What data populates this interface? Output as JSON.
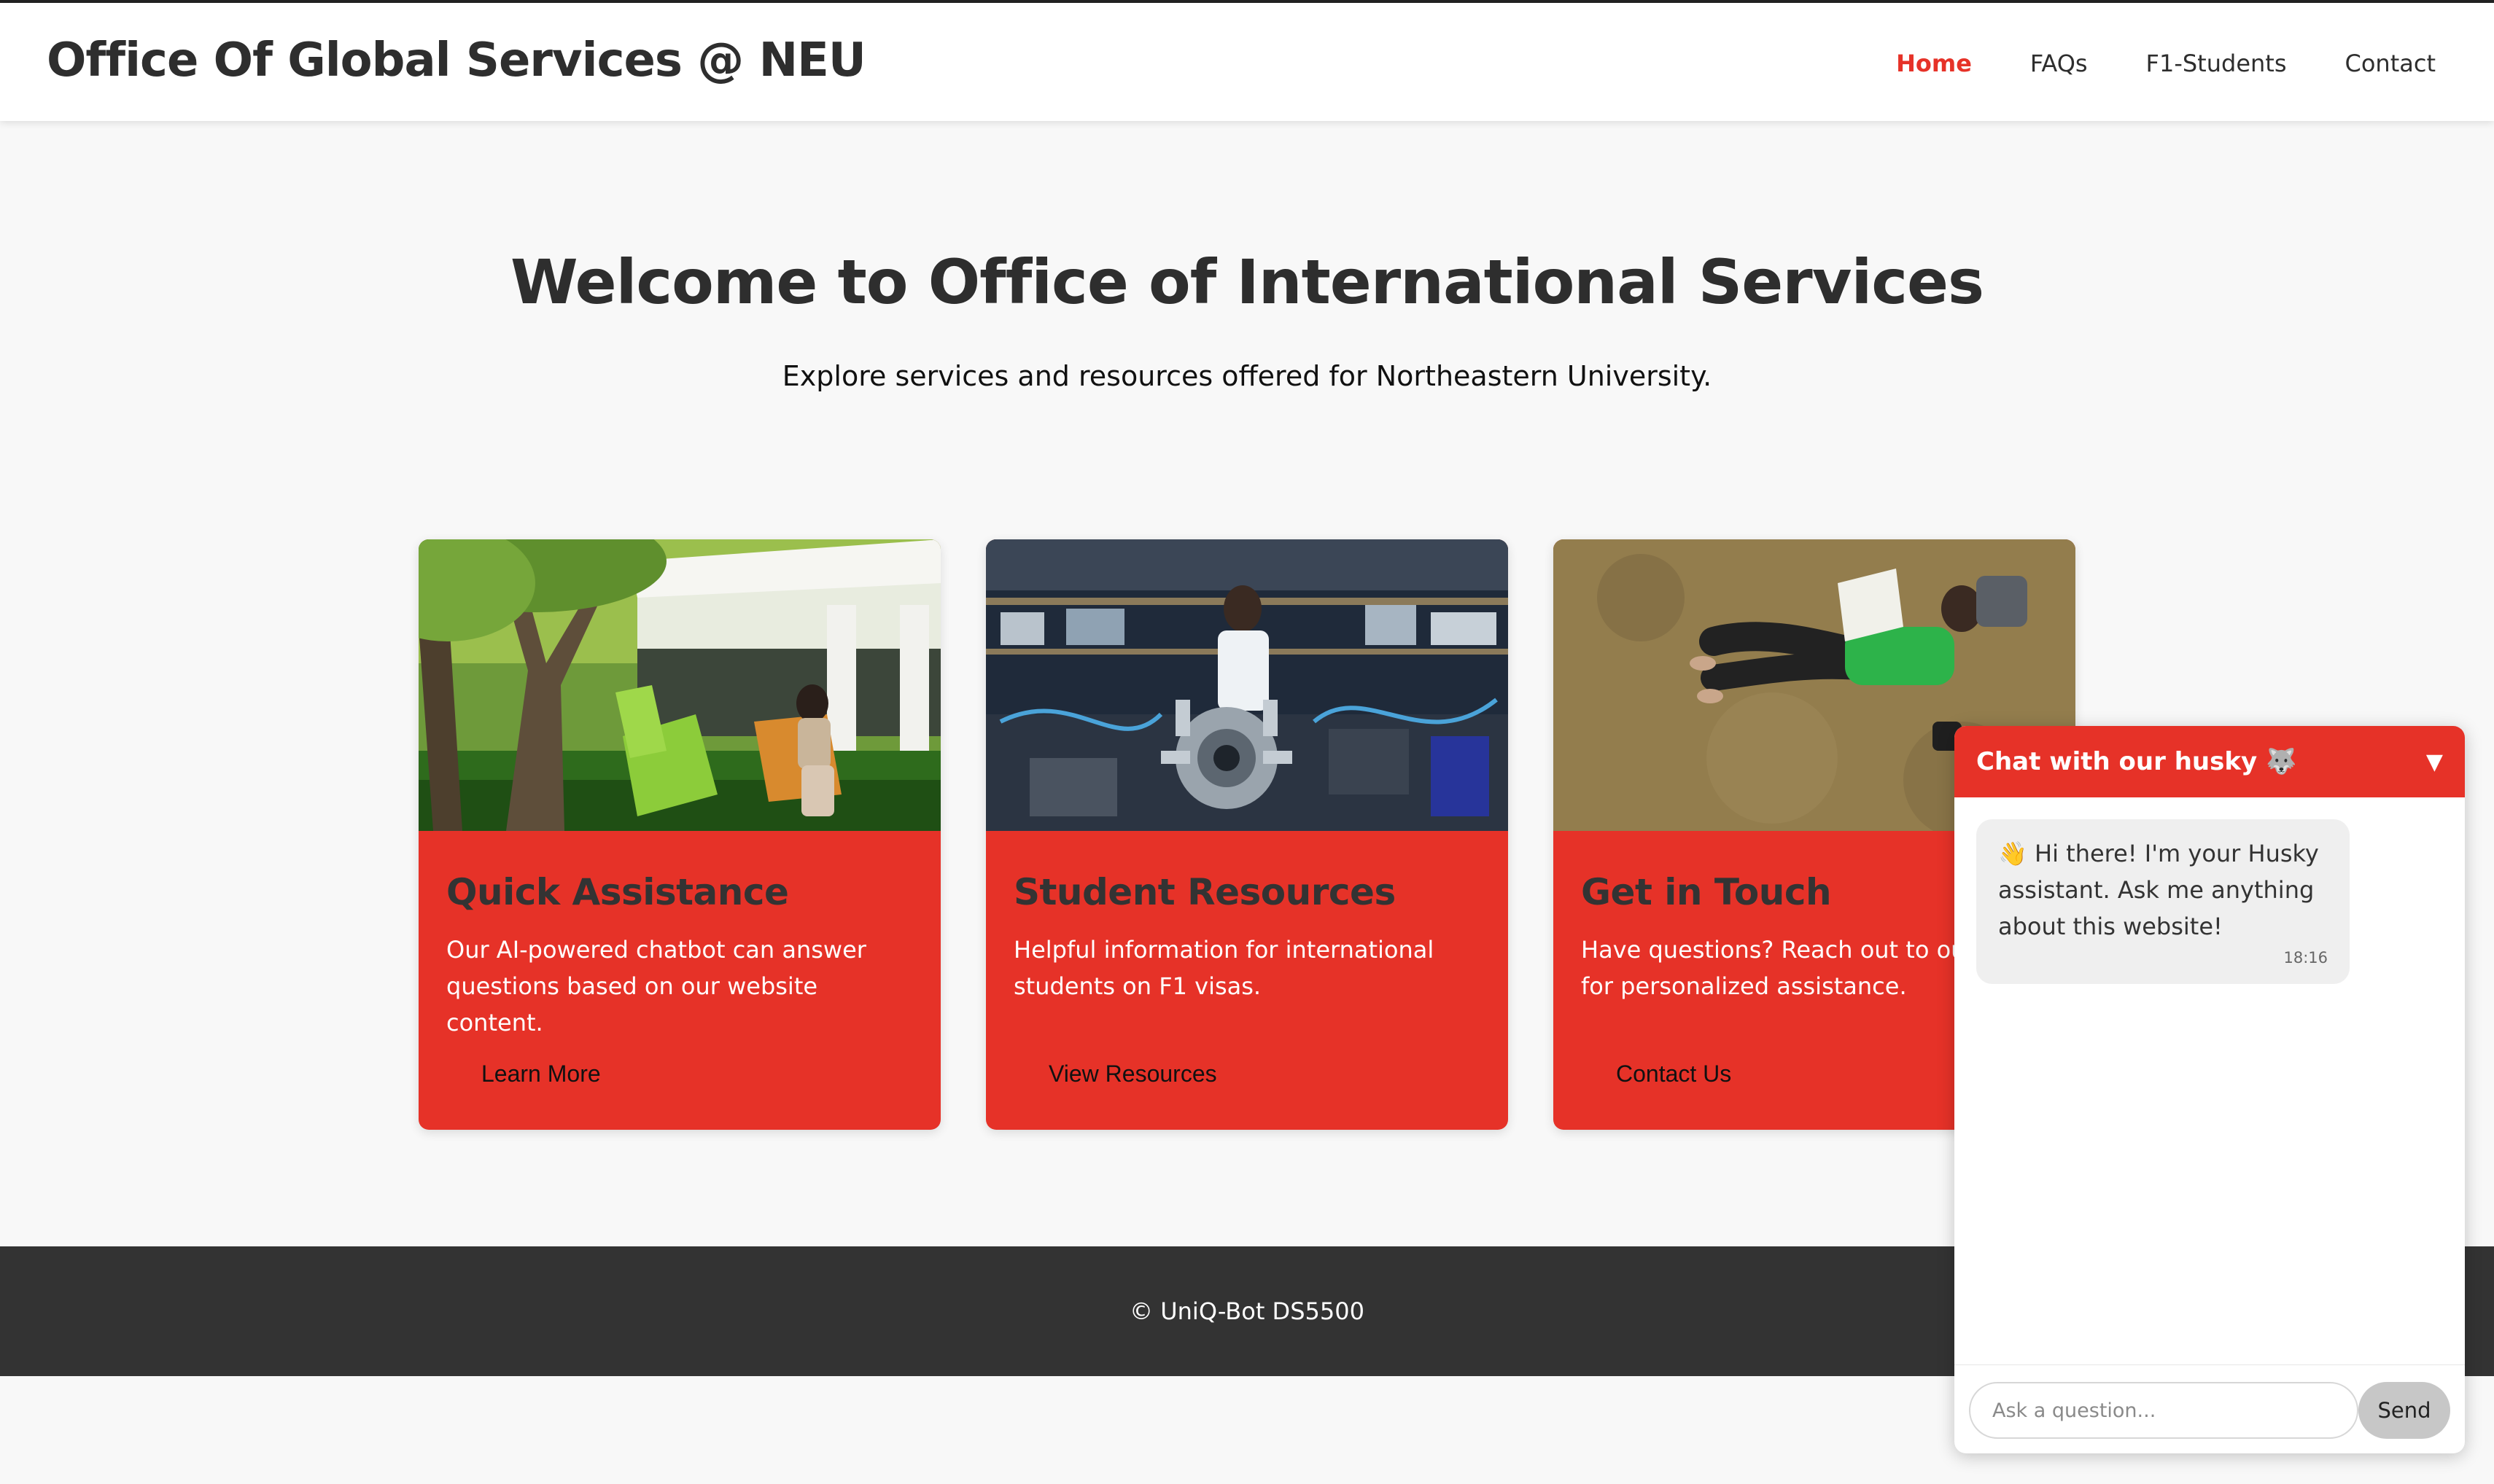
{
  "header": {
    "brand": "Office Of Global Services @ NEU",
    "nav": [
      {
        "label": "Home",
        "active": true
      },
      {
        "label": "FAQs",
        "active": false
      },
      {
        "label": "F1-Students",
        "active": false
      },
      {
        "label": "Contact",
        "active": false
      }
    ]
  },
  "hero": {
    "title": "Welcome to Office of International Services",
    "subtitle": "Explore services and resources offered for Northeastern University."
  },
  "cards": [
    {
      "title": "Quick Assistance",
      "text": "Our AI-powered chatbot can answer questions based on our website content.",
      "button": "Learn More",
      "image": "student-relaxing-outdoors-photo"
    },
    {
      "title": "Student Resources",
      "text": "Helpful information for international students on F1 visas.",
      "button": "View Resources",
      "image": "researcher-in-lab-photo"
    },
    {
      "title": "Get in Touch",
      "text": "Have questions? Reach out to our team for personalized assistance.",
      "button": "Contact Us",
      "image": "student-reading-on-grass-photo"
    }
  ],
  "footer": {
    "text": "© UniQ-Bot DS5500"
  },
  "chat": {
    "title": "Chat with our husky 🐺",
    "toggle": "▼",
    "message": {
      "text": "👋 Hi there! I'm your Husky assistant. Ask me anything about this website!",
      "time": "18:16"
    },
    "input_placeholder": "Ask a question...",
    "send_label": "Send"
  },
  "colors": {
    "accent": "#e63228",
    "footer_bg": "#333333",
    "page_bg": "#f8f8f8"
  }
}
